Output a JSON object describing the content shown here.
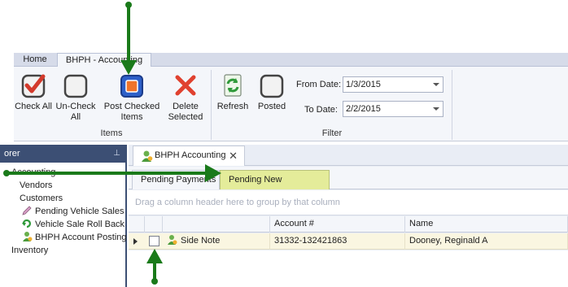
{
  "ribbon_tabs": {
    "home": "Home",
    "active": "BHPH - Accounting"
  },
  "ribbon": {
    "items_group": {
      "label": "Items",
      "check_all": "Check All",
      "uncheck_all": "Un-Check All",
      "post_checked": "Post Checked Items",
      "delete_selected": "Delete Selected"
    },
    "filter_group": {
      "label": "Filter",
      "refresh": "Refresh",
      "posted": "Posted",
      "from_label": "From Date:",
      "from_value": "1/3/2015",
      "to_label": "To Date:",
      "to_value": "2/2/2015"
    }
  },
  "explorer": {
    "title": "orer",
    "items": [
      "Accounting",
      "Vendors",
      "Customers",
      "Pending Vehicle Sales",
      "Vehicle Sale Roll Back",
      "BHPH Account Posting",
      "Inventory"
    ]
  },
  "doc_tab": {
    "label": "BHPH Accounting",
    "close": "✕"
  },
  "sub_tabs": {
    "pending_payments": "Pending Payments",
    "pending_new_accounts": "Pending New Accounts"
  },
  "grid": {
    "group_hint": "Drag a column header here to group by that column",
    "columns": {
      "account": "Account #",
      "name": "Name"
    },
    "rows": [
      {
        "note": "Side Note",
        "account": "31332-132421863",
        "name": "Dooney, Reginald A"
      }
    ]
  },
  "colors": {
    "accent": "#3c4f74",
    "selected_tab": "#e4ec9a",
    "row_highlight": "#faf6e1",
    "annotation_arrow": "#1a7a1a"
  }
}
